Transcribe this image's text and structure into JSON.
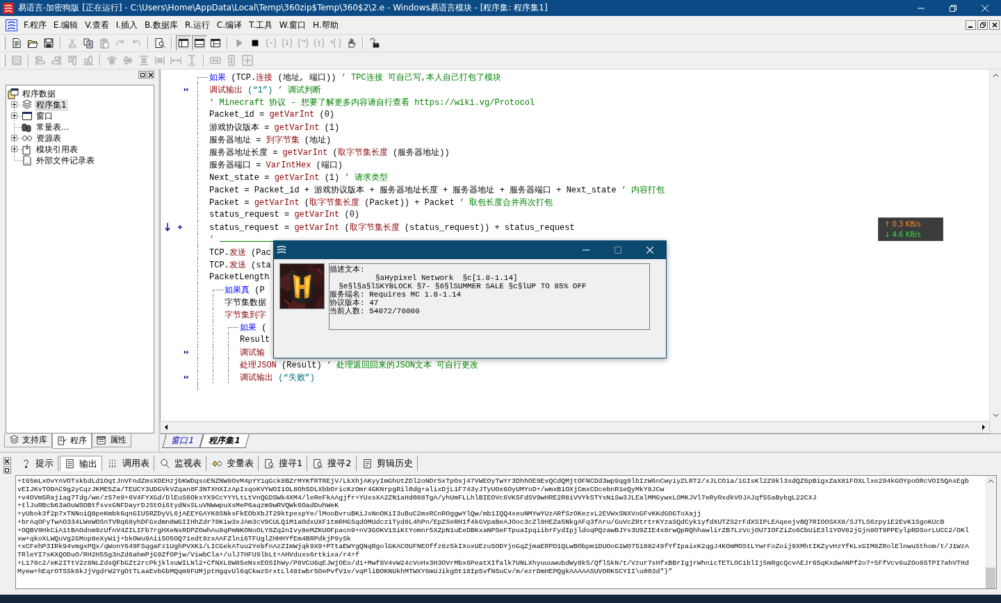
{
  "window": {
    "title": "易语言-加密狗版 [正在运行] - C:\\Users\\Home\\AppData\\Local\\Temp\\360zip$Temp\\360$2\\2.e - Windows易语言模块 - [程序集: 程序集1]"
  },
  "menu": [
    {
      "label": "F.程序"
    },
    {
      "label": "E.编辑"
    },
    {
      "label": "V.查看"
    },
    {
      "label": "I.插入"
    },
    {
      "label": "B.数据库"
    },
    {
      "label": "R.运行"
    },
    {
      "label": "C.编译"
    },
    {
      "label": "T.工具"
    },
    {
      "label": "W.窗口"
    },
    {
      "label": "H.帮助"
    }
  ],
  "toolbars": [
    {
      "groups": [
        [
          {
            "kind": "new",
            "disabled": false,
            "pressed": false
          },
          {
            "kind": "open",
            "disabled": false,
            "pressed": false
          },
          {
            "kind": "save",
            "disabled": false,
            "pressed": false
          }
        ],
        [
          {
            "kind": "cut",
            "disabled": true,
            "pressed": false
          },
          {
            "kind": "copy",
            "disabled": false,
            "pressed": false
          },
          {
            "kind": "paste",
            "disabled": true,
            "pressed": false
          },
          {
            "kind": "redo",
            "disabled": true,
            "pressed": false
          },
          {
            "kind": "undo",
            "disabled": true,
            "pressed": false
          }
        ],
        [
          {
            "kind": "preview",
            "disabled": false,
            "pressed": false
          }
        ],
        [
          {
            "kind": "layout-a",
            "disabled": false,
            "pressed": true
          },
          {
            "kind": "layout-b",
            "disabled": false,
            "pressed": true
          },
          {
            "kind": "layout-c",
            "disabled": false,
            "pressed": false
          }
        ],
        [
          {
            "kind": "run",
            "disabled": true,
            "pressed": false
          },
          {
            "kind": "stop",
            "disabled": false,
            "pressed": false
          },
          {
            "kind": "step",
            "disabled": true,
            "pressed": false
          },
          {
            "kind": "step-in",
            "disabled": true,
            "pressed": false
          },
          {
            "kind": "step-over",
            "disabled": true,
            "pressed": false
          },
          {
            "kind": "step-out",
            "disabled": true,
            "pressed": false
          },
          {
            "kind": "step-cursor",
            "disabled": true,
            "pressed": false
          },
          {
            "kind": "hand",
            "disabled": false,
            "pressed": false
          }
        ],
        [
          {
            "kind": "help",
            "disabled": false,
            "pressed": false
          }
        ]
      ]
    },
    {
      "groups": [
        [
          {
            "kind": "form",
            "disabled": true,
            "pressed": false
          }
        ],
        [
          {
            "kind": "align-left",
            "disabled": true,
            "pressed": false
          },
          {
            "kind": "align-right",
            "disabled": true,
            "pressed": false
          },
          {
            "kind": "align-top",
            "disabled": true,
            "pressed": false
          },
          {
            "kind": "align-bottom",
            "disabled": true,
            "pressed": false
          }
        ],
        [
          {
            "kind": "center-h",
            "disabled": true,
            "pressed": false
          },
          {
            "kind": "center-v",
            "disabled": true,
            "pressed": false
          },
          {
            "kind": "space-v",
            "disabled": true,
            "pressed": false
          },
          {
            "kind": "space-h",
            "disabled": true,
            "pressed": false
          },
          {
            "kind": "spread-h",
            "disabled": true,
            "pressed": false
          },
          {
            "kind": "spread-v",
            "disabled": true,
            "pressed": false
          }
        ],
        [
          {
            "kind": "same-width",
            "disabled": true,
            "pressed": false
          },
          {
            "kind": "same-height",
            "disabled": true,
            "pressed": false
          },
          {
            "kind": "same-size",
            "disabled": true,
            "pressed": false
          }
        ]
      ]
    }
  ],
  "tree": [
    {
      "label": "程序数据",
      "selected": false,
      "children": [
        {
          "label": "程序集1",
          "has_children": true,
          "expanded": false,
          "selected": true
        },
        {
          "label": "窗口",
          "has_children": true,
          "expanded": false,
          "selected": false
        },
        {
          "label": "常量表...",
          "has_children": false,
          "expanded": false,
          "selected": false
        },
        {
          "label": "资源表",
          "has_children": true,
          "expanded": false,
          "selected": false
        },
        {
          "label": "模块引用表",
          "has_children": true,
          "expanded": false,
          "selected": false
        },
        {
          "label": "外部文件记录表",
          "has_children": false,
          "expanded": false,
          "selected": false
        }
      ]
    }
  ],
  "panel_tabs": [
    {
      "label": "支持库",
      "selected": false
    },
    {
      "label": "程序",
      "selected": true
    },
    {
      "label": "属性",
      "selected": false
    }
  ],
  "code": [
    {
      "kind": "statement",
      "segments": [
        {
          "kind": "keyword",
          "text": "如果"
        },
        {
          "kind": "plain",
          "text": " (TCP."
        },
        {
          "kind": "call",
          "text": "连接"
        },
        {
          "kind": "plain",
          "text": " (地址, 端口))"
        },
        {
          "kind": "comment",
          "text": " ’ TPC连接 可自己写,本人自己打包了模块"
        }
      ],
      "children": [
        {
          "kind": "debug",
          "segments": [
            {
              "kind": "call",
              "text": "调试输出"
            },
            {
              "kind": "string",
              "text": " (“1”)"
            },
            {
              "kind": "comment",
              "text": " ’ 调试判断"
            }
          ]
        },
        {
          "kind": "statement",
          "segments": [
            {
              "kind": "comment",
              "text": "’ Minecraft 协议 - 想要了解更多内容请自行查看 https://wiki.vg/Protocol"
            }
          ]
        },
        {
          "kind": "statement",
          "segments": [
            {
              "kind": "plain",
              "text": "Packet_id = "
            },
            {
              "kind": "call",
              "text": "getVarInt"
            },
            {
              "kind": "plain",
              "text": " (0)"
            }
          ]
        },
        {
          "kind": "statement",
          "segments": [
            {
              "kind": "plain",
              "text": "游戏协议版本 = "
            },
            {
              "kind": "call",
              "text": "getVarInt"
            },
            {
              "kind": "plain",
              "text": " (1)"
            }
          ]
        },
        {
          "kind": "statement",
          "segments": [
            {
              "kind": "plain",
              "text": "服务器地址 = "
            },
            {
              "kind": "call",
              "text": "到字节集"
            },
            {
              "kind": "plain",
              "text": " (地址)"
            }
          ]
        },
        {
          "kind": "statement",
          "segments": [
            {
              "kind": "plain",
              "text": "服务器地址长度 = "
            },
            {
              "kind": "call",
              "text": "getVarInt"
            },
            {
              "kind": "plain",
              "text": " ("
            },
            {
              "kind": "call",
              "text": "取字节集长度"
            },
            {
              "kind": "plain",
              "text": " (服务器地址))"
            }
          ]
        },
        {
          "kind": "statement",
          "segments": [
            {
              "kind": "plain",
              "text": "服务器端口 = "
            },
            {
              "kind": "call",
              "text": "VarIntHex"
            },
            {
              "kind": "plain",
              "text": " (端口)"
            }
          ]
        },
        {
          "kind": "statement",
          "segments": [
            {
              "kind": "plain",
              "text": "Next_state = "
            },
            {
              "kind": "call",
              "text": "getVarInt"
            },
            {
              "kind": "plain",
              "text": " (1)"
            },
            {
              "kind": "comment",
              "text": " ’ 请求类型"
            }
          ]
        },
        {
          "kind": "statement",
          "segments": [
            {
              "kind": "plain",
              "text": "Packet = Packet_id + 游戏协议版本 + 服务器地址长度 + 服务器地址 + 服务器端口 + Next_state"
            },
            {
              "kind": "comment",
              "text": " ’ 内容打包"
            }
          ]
        },
        {
          "kind": "statement",
          "segments": [
            {
              "kind": "plain",
              "text": "Packet = "
            },
            {
              "kind": "call",
              "text": "getVarInt"
            },
            {
              "kind": "plain",
              "text": " ("
            },
            {
              "kind": "call",
              "text": "取字节集长度"
            },
            {
              "kind": "plain",
              "text": " (Packet)) + Packet"
            },
            {
              "kind": "comment",
              "text": " ’ 取包长度合并再次打包"
            }
          ]
        },
        {
          "kind": "statement",
          "segments": [
            {
              "kind": "plain",
              "text": "status_request = "
            },
            {
              "kind": "call",
              "text": "getVarInt"
            },
            {
              "kind": "plain",
              "text": " (0)"
            }
          ]
        },
        {
          "kind": "current",
          "segments": [
            {
              "kind": "plain",
              "text": "status_request = "
            },
            {
              "kind": "call",
              "text": "getVarInt"
            },
            {
              "kind": "plain",
              "text": " ("
            },
            {
              "kind": "call",
              "text": "取字节集长度"
            },
            {
              "kind": "plain",
              "text": " (status_request)) + status_request"
            }
          ]
        },
        {
          "kind": "separator",
          "segments": [
            {
              "kind": "comment",
              "text": "’"
            }
          ]
        },
        {
          "kind": "statement",
          "segments": [
            {
              "kind": "plain",
              "text": "TCP."
            },
            {
              "kind": "call",
              "text": "发送"
            },
            {
              "kind": "plain",
              "text": " (Pac"
            }
          ]
        },
        {
          "kind": "statement",
          "segments": [
            {
              "kind": "plain",
              "text": "TCP."
            },
            {
              "kind": "call",
              "text": "发送"
            },
            {
              "kind": "plain",
              "text": " (sta"
            }
          ]
        },
        {
          "kind": "statement",
          "segments": [
            {
              "kind": "plain",
              "text": "PacketLength"
            }
          ]
        },
        {
          "kind": "statement",
          "segments": [
            {
              "kind": "keyword",
              "text": "如果真"
            },
            {
              "kind": "plain",
              "text": " (P"
            }
          ],
          "children": [
            {
              "kind": "statement",
              "segments": [
                {
                  "kind": "plain",
                  "text": "字节集数据"
                }
              ]
            },
            {
              "kind": "statement",
              "segments": [
                {
                  "kind": "call",
                  "text": "字节集到字"
                }
              ]
            },
            {
              "kind": "statement",
              "segments": [
                {
                  "kind": "keyword",
                  "text": "如果"
                },
                {
                  "kind": "plain",
                  "text": " ("
                }
              ],
              "children": [
                {
                  "kind": "statement",
                  "segments": [
                    {
                      "kind": "plain",
                      "text": "Result"
                    }
                  ]
                },
                {
                  "kind": "debug",
                  "segments": [
                    {
                      "kind": "call",
                      "text": "调试输"
                    }
                  ]
                },
                {
                  "kind": "statement",
                  "segments": [
                    {
                      "kind": "call",
                      "text": "处理JSON"
                    },
                    {
                      "kind": "plain",
                      "text": " (Result)"
                    },
                    {
                      "kind": "comment",
                      "text": " ’ 处理返回回来的JSON文本 可自行更改"
                    }
                  ]
                },
                {
                  "kind": "debug",
                  "segments": [
                    {
                      "kind": "call",
                      "text": "调试输出"
                    },
                    {
                      "kind": "string",
                      "text": " (“失败”)"
                    }
                  ]
                }
              ]
            }
          ]
        }
      ]
    }
  ],
  "editor_tabs": [
    {
      "label": "窗口1",
      "selected": false
    },
    {
      "label": "程序集1",
      "selected": true
    }
  ],
  "dialog": {
    "description": [
      "描述文本:",
      "          §aHypixel Network  §c[1.8-1.14]",
      "  §e§l§a§lSKYBLOCK §7- §6§lSUMMER SALE §c§lUP TO 85% OFF",
      "服务端名: Requires MC 1.8-1.14",
      "协议版本: 47",
      "当前人数: 54072/70000"
    ]
  },
  "net_speed": {
    "upload": "↑ 0.3 KB/s",
    "download": "↓ 4.6 KB/s"
  },
  "output_tabs": [
    {
      "label": "提示",
      "selected": false
    },
    {
      "label": "输出",
      "selected": true
    },
    {
      "label": "调用表",
      "selected": false
    },
    {
      "label": "监视表",
      "selected": false
    },
    {
      "label": "变量表",
      "selected": false
    },
    {
      "label": "搜寻1",
      "selected": false
    },
    {
      "label": "搜寻2",
      "selected": false
    },
    {
      "label": "剪辑历史",
      "selected": false
    }
  ],
  "output": [
    "+t65mLxOvYAVOTskbdLd1OqtJnVFndZmsXDEHzjbKWDqsoENZNW8OvM4pYY1qGck8BZrMYKfRTREjV/LkXhjAKyyImGhUtZDl2oNDr5xTpOsj47VWEOyTwYr3DhhOE9EvQCdQMjtOFNCDd3wp9qg9lbIzW6nCwyiyZLRT2/xJLCOia/iGIsKl2Z9kl3sdQZ6pBigxZaX81FOXLlxe294kGOYpoORcVOI5QAsEgb",
    "vEIJKvTODAC9g2yCqzJKME5Za/TEUCY3UDGVkVZqan8F3NTXHXIzApIxqoKVYWOI1OL8Oh5DLXbbOricKzOmr4GKNrpgRil0dg+alixDjL1F743yJTyUOx6OyUMYoD+/wmxB1OXjCmxCDcebnR1eQyMkY8JCw",
    "+v4OVm5Rajiag7Tdg/we/zS7e9+6V4FYXGd/DlEuS6OksYX9CcYYYLtLtVnQGDSWk4XM4/leReFkAAgjfr+YUxsXA2ZN1aHd088TgA/yhUmFLLhlBIEOVc6VK5FdSV9wHRE2R8iVVYk5TYsNiSw3JLEalMMGywxLOMKJVl7eRyRxdkVOJAJqf55aBybgL22CXJ",
    "+tlJuRBcb63aOuWSOBtfsvxGNFDayrDJStOi6tydNsSLuVNWwpuXsMeP6aqzm9wRVQWk6OadDuhWeK",
    "+yUbok3f2p7xTNNoiQ8peKmbk6qnGIU5RZDyVL6jAEEYGAYK8SNksFkEObXbJT29ktpespYe/lMooBvruBKiJsNnOKiI3uBuC2mxRCnROggwYlQw/mb1IQQ4xeuNMYwYUzARfSzOKezxL2EVWxSNXVoGFvKKdGOGToXajj",
    "+brAqOFyTwAO334LWeWOSnTVRq68yhDFGxdmn8WGIIHhZdr78Kiw3xJAm3cV9CULQiM1aOdxUXF1tmRHGSqdOMUdcz1Tyd8L4hPn/EpZSeRH1f4kGVpaBeAJOoc3cZl9HEZa5NkgAFq3fAru/GuVcZRtrtrKYzaSQdCyk1yfdXUTZS2rFdXSIPLEAqeejvBQ7RIOOSXX8/SJTLS6zpyiE2EvK1SgoKUcB",
    "+OQBV9HkCiA1tBAOdnm9zUfnV4ZILIFb7rgHXeNsRDPZOwhAu9qPmNKONoOLY8Zq2nIvy8eMZKUOFpacn9+nV3GOKV1SiKtYomnr5XZpN1uEeDBKxaNPSeFTpuaIpqiibrFydIpjldoqPQzawBJYs3U9ZIE4x8rwQpRQhhawlirZB7LzVcjOU7IOFZiZo6CbUiE3l1YOV82jGjn8OT9PPEylpRDSorLUCC2/OKl",
    "xw+qkoXLWQuVg2GMop8eXyWij+bkOWu9Aii5O5OQ71edt9zxAAFZlni6TFUglZHHHYfEm4BRPdkjP9ySk",
    "+xCFehP3IRk94vmgxPQx/qWonY649FSqgaFz1UghPVXK1/LICGekATuu2YebfnAzZImWjqk9X9+PTtaEWYgQNqRgolGKACOUFNEOffz8z5kIXoxUEzu5ODYjnGqZjmaERPD1QLwBObpm1DUOoG1WO75188249fYfIpaixK2qgJ4KOmMOStLYwrFoZoij9XMhtIKZyvHzYfKLxGIM8ZRolElnwuSthom/t/J1WzA",
    "TRleYI7sKXQODuO/RH2H55g3nZd6ahmPjG9ZfOPjw/ViwbCla+/ulJ7HFU9lbLt+AHVduxs6rtkixa/r4+f",
    "+L178c2/eK2ITtV2z8NLZdsQFbGZt2rcPkjklsuWILNl2+CfNXL8W85eNsxEOSIhWy/P8VCU6qEJWjOEo/d1+Mwf8V4vW24cVoHx3H3OVrMbx6PeatXIfalk7UNLXhyuuuwubdWy8k5/Qfl5kN/t/Vzur7sHfxBBrIgjrWhnicTETLOCiblIj5mRgcQcvAEJr65qKxdwANPf2o7+5FfVcv6uZOo65TPI7ahVTHd",
    "Myew+hEqrOTSSk6kJjVgdrW2YgOtTLaaEvbGbMQqm9FUMjptHgqvUl6qCkwzSrxtLl48twbr5OePvfV1v/vqPliBOKNUkhMTWXY6mUJikgOt18Ip5vfN5uCv/m/ezrDmHEPQgkAAAAASUVORK5CYII\\u003d\"}”"
  ]
}
